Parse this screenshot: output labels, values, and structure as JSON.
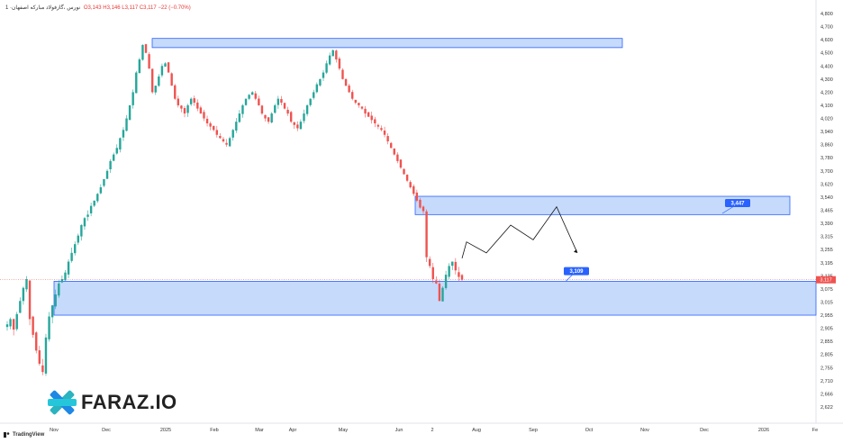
{
  "header": {
    "title": "1 ·نورس ،گاز‌فولاد مبارکه اصفهان",
    "ohlc": "O3,143 H3,146 L3,117 C3,117 −22 (−0.70%)"
  },
  "branding": {
    "logo_text": "FARAZ.IO",
    "footer_text": "TradingView"
  },
  "colors": {
    "up": "#26a69a",
    "down": "#ef5350",
    "zone_fill": "#bcd3fb",
    "zone_stroke": "#2962ff",
    "label_bg": "#2962ff"
  },
  "chart_data": {
    "type": "candlestick",
    "y_axis": {
      "ticks": [
        4800,
        4700,
        4600,
        4500,
        4400,
        4300,
        4200,
        4100,
        4020,
        3940,
        3860,
        3780,
        3700,
        3620,
        3540,
        3465,
        3390,
        3315,
        3255,
        3195,
        3135,
        3075,
        3015,
        2955,
        2905,
        2855,
        2805,
        2755,
        2710,
        2666,
        2622
      ],
      "labels": [
        "4,800",
        "4,700",
        "4,600",
        "4,500",
        "4,400",
        "4,300",
        "4,200",
        "4,100",
        "4,020",
        "3,940",
        "3,860",
        "3,780",
        "3,700",
        "3,620",
        "3,540",
        "3,465",
        "3,390",
        "3,315",
        "3,255",
        "3,195",
        "3,135",
        "3,075",
        "3,015",
        "2,955",
        "2,905",
        "2,855",
        "2,805",
        "2,755",
        "2,710",
        "2,666",
        "2,622"
      ],
      "scale": "log"
    },
    "x_axis": {
      "labels": [
        "Nov",
        "Dec",
        "2025",
        "Feb",
        "Mar",
        "Apr",
        "May",
        "Jun",
        "2",
        "Aug",
        "Sep",
        "Oct",
        "Nov",
        "Dec",
        "2026",
        "Fe"
      ]
    },
    "last_price": {
      "value": 3117,
      "label": "3,117"
    },
    "zones": [
      {
        "name": "top",
        "from": 4540,
        "to": 4610
      },
      {
        "name": "middle",
        "from": 3440,
        "to": 3545
      },
      {
        "name": "bottom",
        "from": 2955,
        "to": 3110
      }
    ],
    "labels": [
      {
        "text": "3,447",
        "value": 3447
      },
      {
        "text": "3,109",
        "value": 3109
      }
    ],
    "projection": [
      3215,
      3290,
      3240,
      3380,
      3300,
      3485,
      3240
    ],
    "closes": [
      2920,
      2940,
      2900,
      2960,
      3020,
      3080,
      3120,
      2940,
      2880,
      2820,
      2770,
      2740,
      2870,
      2950,
      3000,
      3050,
      3100,
      3120,
      3150,
      3200,
      3240,
      3280,
      3320,
      3380,
      3420,
      3440,
      3490,
      3520,
      3560,
      3600,
      3650,
      3700,
      3760,
      3800,
      3840,
      3900,
      3950,
      4020,
      4100,
      4200,
      4350,
      4450,
      4560,
      4500,
      4380,
      4200,
      4250,
      4320,
      4400,
      4420,
      4350,
      4250,
      4150,
      4100,
      4080,
      4050,
      4100,
      4150,
      4120,
      4080,
      4050,
      4020,
      3990,
      3970,
      3950,
      3920,
      3900,
      3880,
      3860,
      3900,
      3950,
      4000,
      4050,
      4100,
      4150,
      4180,
      4200,
      4150,
      4100,
      4050,
      4020,
      4000,
      4050,
      4100,
      4150,
      4120,
      4080,
      4050,
      4000,
      3980,
      3960,
      4000,
      4050,
      4100,
      4150,
      4200,
      4260,
      4300,
      4350,
      4420,
      4480,
      4520,
      4450,
      4380,
      4300,
      4250,
      4200,
      4150,
      4120,
      4100,
      4080,
      4050,
      4030,
      4010,
      3990,
      3970,
      3950,
      3920,
      3880,
      3840,
      3800,
      3760,
      3720,
      3680,
      3640,
      3600,
      3560,
      3520,
      3480,
      3460,
      3220,
      3180,
      3120,
      3100,
      3020,
      3080,
      3140,
      3180,
      3200,
      3160,
      3130,
      3117
    ]
  }
}
